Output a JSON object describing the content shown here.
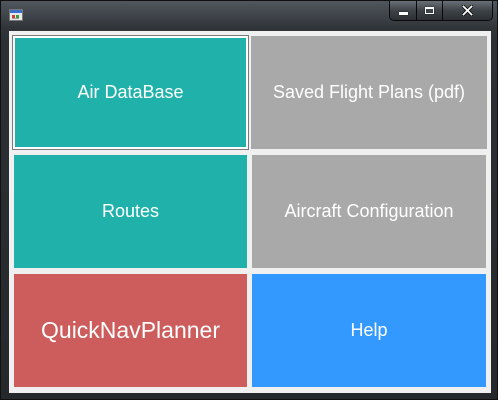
{
  "window": {
    "colors": {
      "frame": "#2c3034",
      "client": "#f0f0f0"
    },
    "icon": "app-window-icon",
    "caption_buttons": [
      {
        "name": "minimize",
        "icon": "minimize-icon"
      },
      {
        "name": "maximize",
        "icon": "maximize-icon"
      },
      {
        "name": "close",
        "icon": "close-icon"
      }
    ]
  },
  "tiles": {
    "air_database": {
      "label": "Air DataBase",
      "color": "#20b2aa"
    },
    "saved_flight_plans": {
      "label": "Saved Flight Plans (pdf)",
      "color": "#a9a9a9"
    },
    "routes": {
      "label": "Routes",
      "color": "#20b2aa"
    },
    "aircraft_configuration": {
      "label": "Aircraft Configuration",
      "color": "#a9a9a9"
    },
    "quicknavplanner": {
      "label": "QuickNavPlanner",
      "color": "#cd5c5c"
    },
    "help": {
      "label": "Help",
      "color": "#3399ff"
    }
  }
}
